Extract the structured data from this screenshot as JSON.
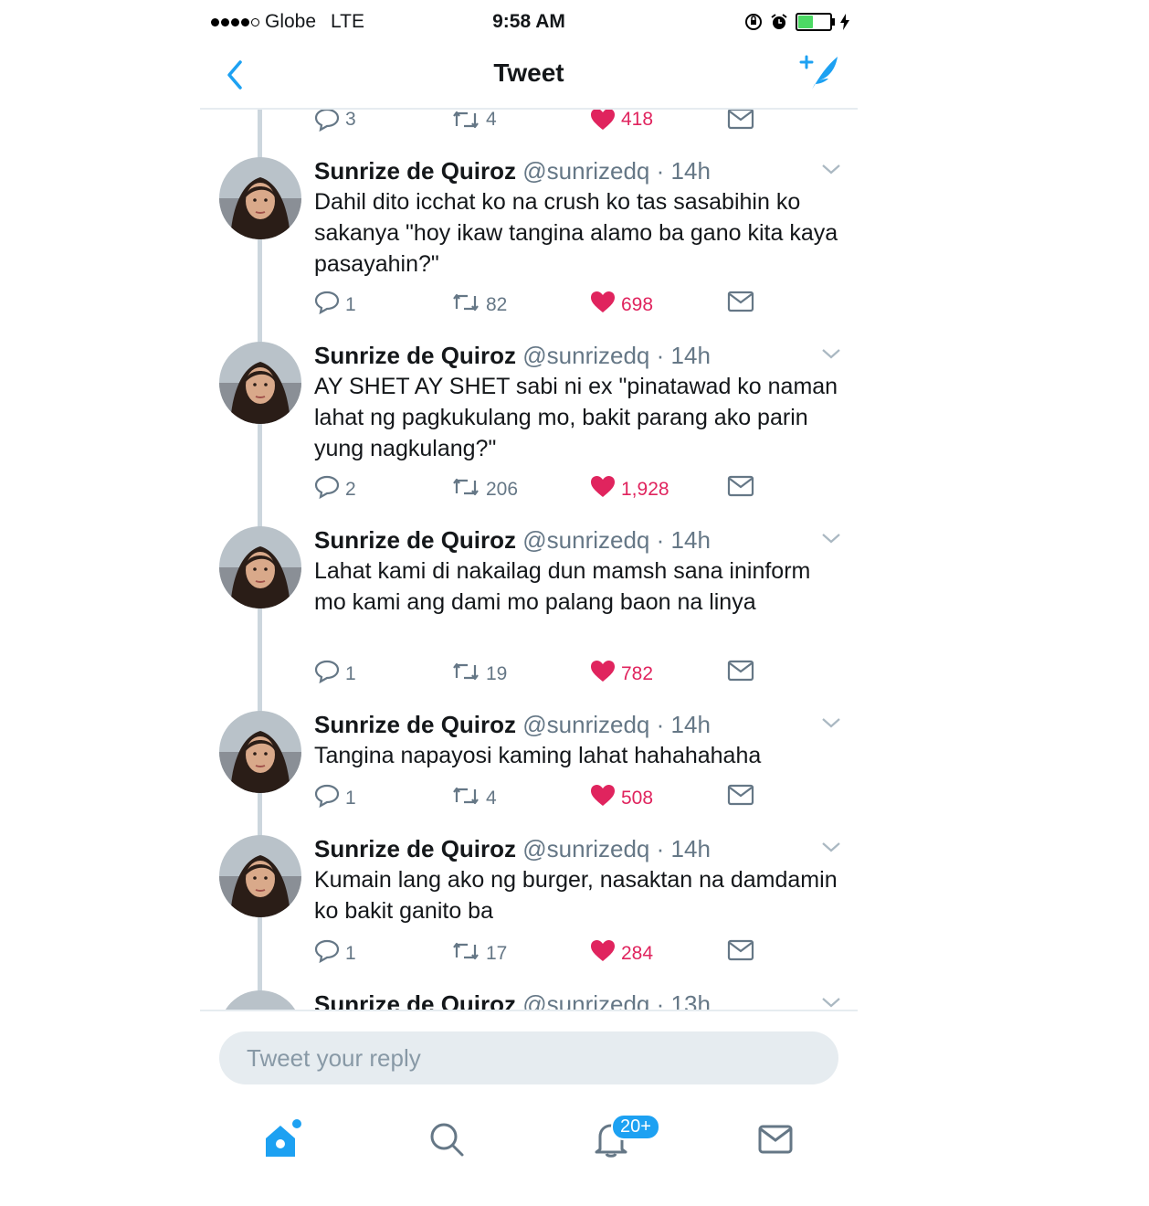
{
  "status_bar": {
    "carrier": "Globe",
    "network": "LTE",
    "time": "9:58 AM"
  },
  "nav": {
    "title": "Tweet"
  },
  "partial_actions": {
    "replies": "3",
    "retweets": "4",
    "likes": "418"
  },
  "tweets": [
    {
      "name": "Sunrize de Quiroz",
      "handle": "@sunrizedq",
      "time": "· 14h",
      "text": "Dahil dito icchat ko na crush ko tas sasabihin ko sakanya \"hoy ikaw tangina alamo ba gano kita kaya pasayahin?\"",
      "replies": "1",
      "retweets": "82",
      "likes": "698"
    },
    {
      "name": "Sunrize de Quiroz",
      "handle": "@sunrizedq",
      "time": "· 14h",
      "text": "AY SHET AY SHET sabi ni ex \"pinatawad ko naman lahat ng pagkukulang mo, bakit parang ako parin yung nagkulang?\"",
      "replies": "2",
      "retweets": "206",
      "likes": "1,928"
    },
    {
      "name": "Sunrize de Quiroz",
      "handle": "@sunrizedq",
      "time": "· 14h",
      "text": "Lahat kami di nakailag dun mamsh sana ininform mo kami ang dami mo palang baon na linya",
      "replies": "1",
      "retweets": "19",
      "likes": "782"
    },
    {
      "name": "Sunrize de Quiroz",
      "handle": "@sunrizedq",
      "time": "· 14h",
      "text": "Tangina napayosi kaming lahat hahahahaha",
      "replies": "1",
      "retweets": "4",
      "likes": "508"
    },
    {
      "name": "Sunrize de Quiroz",
      "handle": "@sunrizedq",
      "time": "· 14h",
      "text": "Kumain lang ako ng burger, nasaktan na damdamin ko bakit ganito ba",
      "replies": "1",
      "retweets": "17",
      "likes": "284"
    },
    {
      "name": "Sunrize de Quiroz",
      "handle": "@sunrizedq",
      "time": "· 13h"
    }
  ],
  "reply": {
    "placeholder": "Tweet your reply"
  },
  "tabbar": {
    "notifications_badge": "20+"
  },
  "colors": {
    "accent": "#1da1f2",
    "like": "#e0245e",
    "muted": "#657786",
    "divider": "#e6ecf0"
  }
}
